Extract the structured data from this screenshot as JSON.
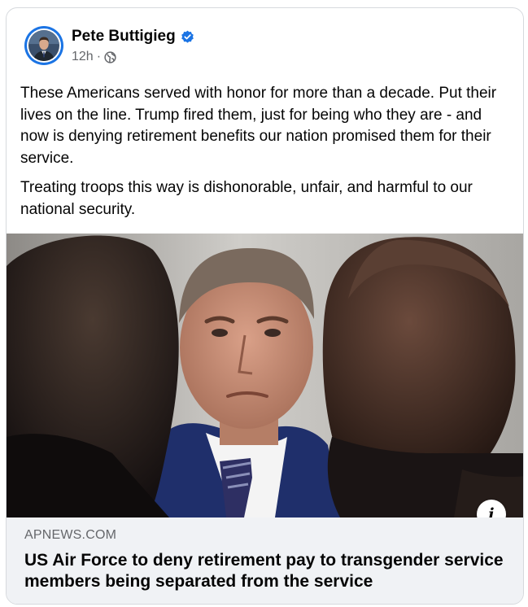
{
  "post": {
    "author": "Pete Buttigieg",
    "timestamp": "12h",
    "separator": "·",
    "audience_icon": "globe-icon",
    "verified_icon": "verified-badge-icon",
    "paragraphs": [
      "These Americans served with honor for more than a decade. Put their lives on the line. Trump fired them, just for being who they are - and now is denying retirement benefits our nation promised them for their service.",
      "Treating troops this way is dishonorable, unfair, and harmful to our national security."
    ]
  },
  "link": {
    "domain": "APNEWS.COM",
    "title": "US Air Force to deny retirement pay to transgender service members being separated from the service",
    "info_label": "i"
  },
  "colors": {
    "accent": "#1b74e4",
    "text": "#050505",
    "secondary_text": "#65676b",
    "footer_bg": "#f0f2f5"
  }
}
